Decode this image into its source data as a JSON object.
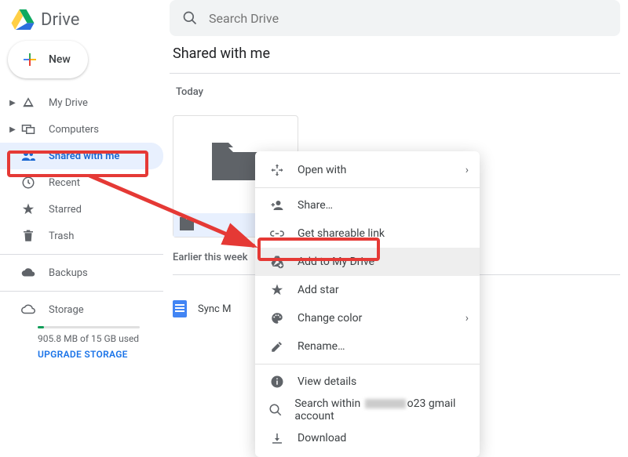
{
  "app": {
    "name": "Drive"
  },
  "newButton": {
    "label": "New"
  },
  "search": {
    "placeholder": "Search Drive"
  },
  "nav": {
    "myDrive": "My Drive",
    "computers": "Computers",
    "sharedWithMe": "Shared with me",
    "recent": "Recent",
    "starred": "Starred",
    "trash": "Trash",
    "backups": "Backups",
    "storage": "Storage"
  },
  "storage": {
    "usage": "905.8 MB of 15 GB used",
    "upgrade": "UPGRADE STORAGE"
  },
  "page": {
    "title": "Shared with me",
    "sections": {
      "today": "Today",
      "earlier": "Earlier this week"
    },
    "folder": {
      "name": ""
    },
    "doc": {
      "name": "Sync M"
    }
  },
  "contextMenu": {
    "openWith": "Open with",
    "share": "Share…",
    "getLink": "Get shareable link",
    "addToDrive": "Add to My Drive",
    "addStar": "Add star",
    "changeColor": "Change color",
    "rename": "Rename…",
    "viewDetails": "View details",
    "searchWithinPrefix": "Search within ",
    "searchWithinSuffix": "o23 gmail account",
    "download": "Download"
  }
}
